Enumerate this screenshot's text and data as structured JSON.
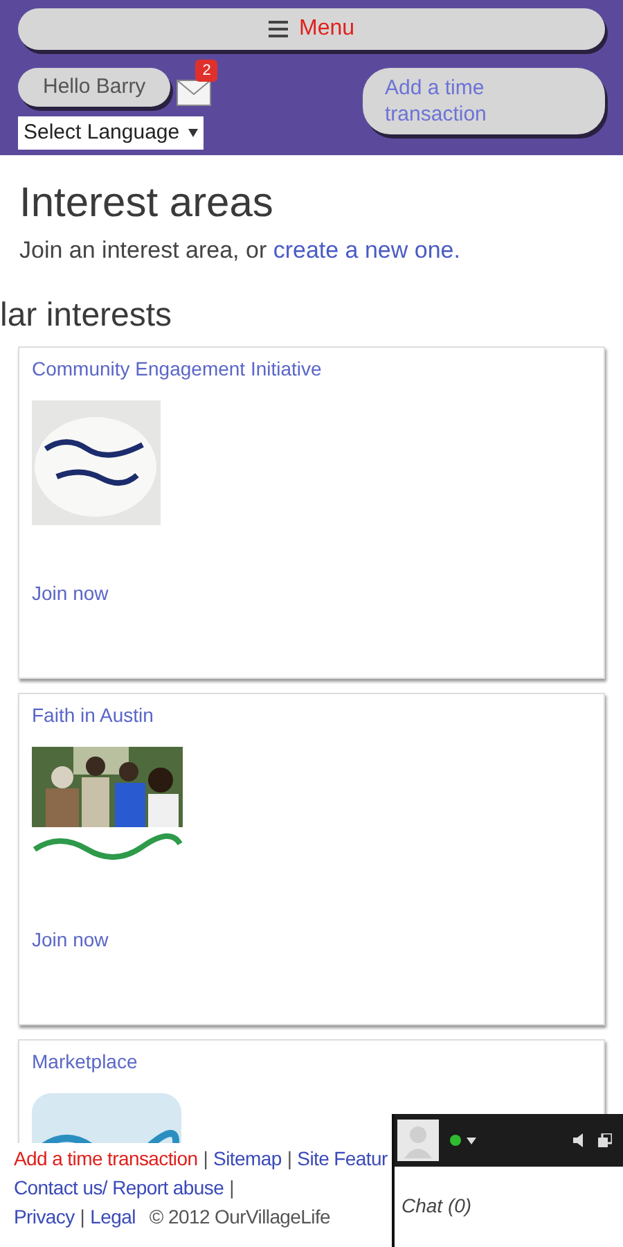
{
  "header": {
    "menu_button": "Menu",
    "greeting": "Hello Barry",
    "messages_badge": "2",
    "add_button": "Add a time transaction",
    "language_select": "Select Language"
  },
  "page": {
    "title": "Interest areas",
    "intro": "Join an interest area, or ",
    "intro_link": "create a new one.",
    "section_heading": "lar interests"
  },
  "cards": [
    {
      "title": "Community Engagement Initiative",
      "action": "Join now"
    },
    {
      "title": "Faith in Austin",
      "action": "Join now"
    },
    {
      "title": "Marketplace"
    }
  ],
  "footer": {
    "first_line": [
      {
        "kind": "highlight_link",
        "label": "Add a time transaction"
      },
      {
        "kind": "separator",
        "label": "|"
      },
      {
        "kind": "link",
        "label": "Sitemap"
      },
      {
        "kind": "separator",
        "label": "|"
      },
      {
        "kind": "link",
        "label": "Site Featur"
      }
    ],
    "second_line": [
      {
        "kind": "link",
        "label": "Contact us/ Report abuse"
      },
      {
        "kind": "separator",
        "label": "|"
      }
    ],
    "third_line": [
      {
        "kind": "link",
        "label": "Privacy"
      },
      {
        "kind": "separator",
        "label": "|"
      },
      {
        "kind": "link",
        "label": "Legal"
      },
      {
        "kind": "text",
        "label": "© 2012 OurVillageLife"
      }
    ]
  },
  "chat": {
    "title": "Chat (0)"
  }
}
